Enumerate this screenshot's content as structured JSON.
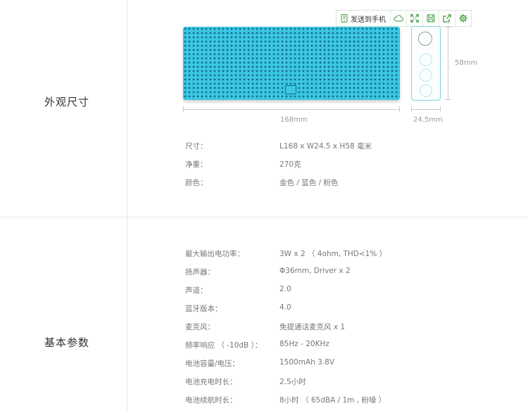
{
  "toolbar": {
    "send_label": "发送到手机",
    "icons": [
      "phone-icon",
      "cloud-icon",
      "fullscreen-icon",
      "save-icon",
      "share-icon",
      "settings-icon"
    ]
  },
  "appearance": {
    "title": "外观尺寸",
    "dimensions": {
      "length": "168mm",
      "width": "24.5mm",
      "height": "58mm"
    },
    "specs": [
      {
        "label": "尺寸：",
        "value": "L168 x W24.5 x H58 毫米"
      },
      {
        "label": "净重：",
        "value": "270克"
      },
      {
        "label": "颜色：",
        "value": "金色 / 蓝色 / 粉色"
      }
    ]
  },
  "basic": {
    "title": "基本参数",
    "specs": [
      {
        "label": "最大输出电功率：",
        "value": "3W x 2 （ 4ohm, THD<1% ）"
      },
      {
        "label": "扬声器：",
        "value": "Φ36mm, Driver x 2"
      },
      {
        "label": "声道：",
        "value": "2.0"
      },
      {
        "label": "蓝牙版本：",
        "value": "4.0"
      },
      {
        "label": "麦克风：",
        "value": "免提通话麦克风 x 1"
      },
      {
        "label": "频率响应 （ -10dB ）：",
        "value": "85Hz - 20KHz"
      },
      {
        "label": "电池容量/电压：",
        "value": "1500mAh 3.8V"
      },
      {
        "label": "电池充电时长：",
        "value": "2.5小时"
      },
      {
        "label": "电池续航时长：",
        "value": "8小时 （ 65dBA / 1m , 粉噪 ）"
      }
    ]
  },
  "colors": {
    "speaker": "#3cc6e4",
    "speaker_holes": "#0f6e86",
    "toolbar_accent": "#3a9a3a"
  }
}
